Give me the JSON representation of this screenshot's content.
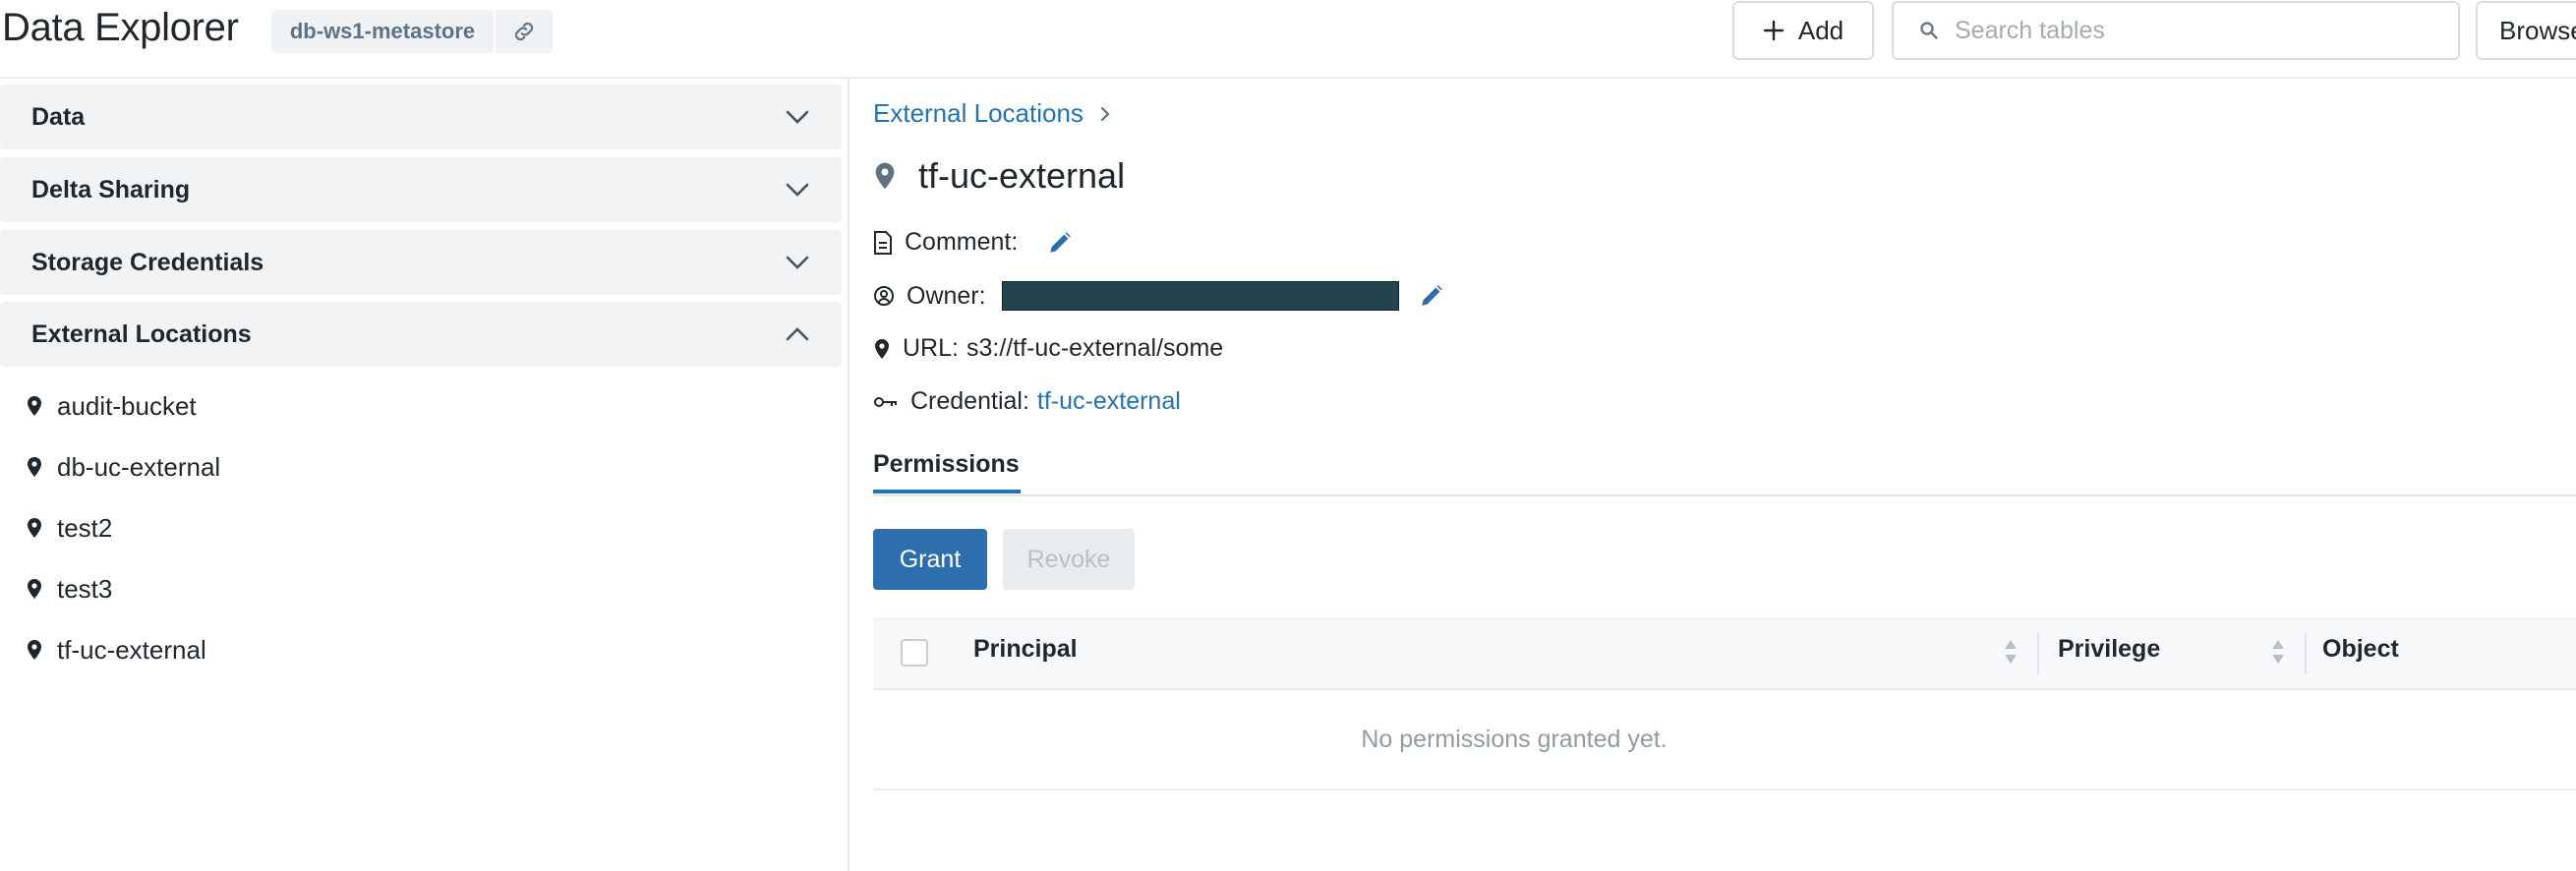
{
  "header": {
    "title": "Data Explorer",
    "metastore": "db-ws1-metastore",
    "add_label": "Add",
    "search_placeholder": "Search tables",
    "browse_label": "Browse"
  },
  "sidebar": {
    "sections": [
      {
        "label": "Data",
        "expanded": false
      },
      {
        "label": "Delta Sharing",
        "expanded": false
      },
      {
        "label": "Storage Credentials",
        "expanded": false
      },
      {
        "label": "External Locations",
        "expanded": true
      }
    ],
    "locations": [
      "audit-bucket",
      "db-uc-external",
      "test2",
      "test3",
      "tf-uc-external"
    ]
  },
  "main": {
    "breadcrumb": "External Locations",
    "title": "tf-uc-external",
    "comment_label": "Comment:",
    "owner_label": "Owner:",
    "url_label": "URL:",
    "url_value": "s3://tf-uc-external/some",
    "credential_label": "Credential:",
    "credential_value": "tf-uc-external",
    "tab": "Permissions",
    "grant_label": "Grant",
    "revoke_label": "Revoke",
    "columns": [
      "Principal",
      "Privilege",
      "Object"
    ],
    "empty_text": "No permissions granted yet."
  },
  "colors": {
    "accent": "#2272b4",
    "grant_button": "#2f6ead",
    "redacted": "#23434f"
  }
}
